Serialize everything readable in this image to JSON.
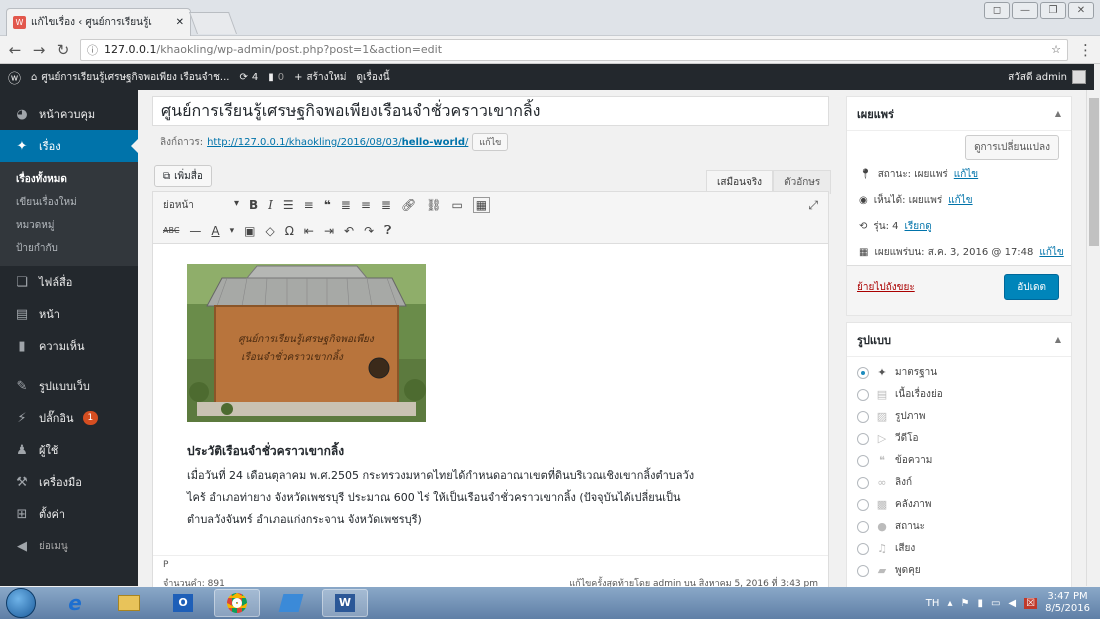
{
  "browser": {
    "tab_title": "แก้ไขเรื่อง ‹ ศูนย์การเรียนรู้เ",
    "url_host": "127.0.0.1",
    "url_path": "/khaokling/wp-admin/post.php?post=1&action=edit"
  },
  "adminbar": {
    "site": "ศูนย์การเรียนรู้เศรษฐกิจพอเพียง เรือนจำช...",
    "updates": "4",
    "comments": "0",
    "new_label": "สร้างใหม่",
    "view_label": "ดูเรื่องนี้",
    "greeting": "สวัสดี admin"
  },
  "sidebar": {
    "items": [
      {
        "label": "หน้าควบคุม",
        "icon": "dashboard-icon"
      },
      {
        "label": "เรื่อง",
        "icon": "pin-icon"
      },
      {
        "label": "ไฟล์สื่อ",
        "icon": "media-icon"
      },
      {
        "label": "หน้า",
        "icon": "page-icon"
      },
      {
        "label": "ความเห็น",
        "icon": "comment-icon"
      },
      {
        "label": "รูปแบบเว็บ",
        "icon": "appearance-icon"
      },
      {
        "label": "ปลั๊กอิน",
        "icon": "plugin-icon",
        "badge": "1"
      },
      {
        "label": "ผู้ใช้",
        "icon": "users-icon"
      },
      {
        "label": "เครื่องมือ",
        "icon": "tools-icon"
      },
      {
        "label": "ตั้งค่า",
        "icon": "settings-icon"
      },
      {
        "label": "ย่อเมนู",
        "icon": "collapse-icon"
      }
    ],
    "submenu": [
      "เรื่องทั้งหมด",
      "เขียนเรื่องใหม่",
      "หมวดหมู่",
      "ป้ายกำกับ"
    ]
  },
  "post": {
    "title": "ศูนย์การเรียนรู้เศรษฐกิจพอเพียงเรือนจำชั่วคราวเขากลิ้ง",
    "permalink_label": "ลิงก์ถาวร:",
    "permalink_base": "http://127.0.0.1/khaokling/2016/08/03/",
    "permalink_slug": "hello-world",
    "edit_btn": "แก้ไข",
    "add_media": "เพิ่มสื่อ",
    "tab_visual": "เสมือนจริง",
    "tab_text": "ตัวอักษร",
    "format_select": "ย่อหน้า",
    "photo_sign_line1": "ศูนย์การเรียนรู้เศรษฐกิจพอเพียง",
    "photo_sign_line2": "เรือนจำชั่วคราวเขากลิ้ง",
    "heading": "ประวัติเรือนจำชั่วคราวเขากลิ้ง",
    "paragraph": "เมื่อวันที่ 24 เดือนตุลาคม พ.ศ.2505 กระทรวงมหาดไทยได้กำหนดอาณาเขตที่ดินบริเวณเชิงเขากลิ้งตำบลวังไคร้ อำเภอท่ายาง จังหวัดเพชรบุรี ประมาณ 600 ไร่ ให้เป็นเรือนจำชั่วคราวเขากลิ้ง (ปัจจุบันได้เปลี่ยนเป็น ตำบลวังจันทร์ อำเภอแก่งกระจาน จังหวัดเพชรบุรี)",
    "path": "P",
    "word_count": "จำนวนคำ: 891",
    "last_edited": "แก้ไขครั้งสุดท้ายโดย admin บน สิงหาคม 5, 2016 ที่ 3:43 pm"
  },
  "publish": {
    "title": "เผยแพร่",
    "preview_btn": "ดูการเปลี่ยนแปลง",
    "status_label": "สถานะ: เผยแพร่",
    "visibility_label": "เห็นได้: เผยแพร่",
    "revisions_label": "รุ่น: 4",
    "revisions_link": "เรียกดู",
    "published_label": "เผยแพร่บน: ส.ค. 3, 2016 @ 17:48",
    "edit_link": "แก้ไข",
    "trash": "ย้ายไปถังขยะ",
    "update": "อัปเดต"
  },
  "format": {
    "title": "รูปแบบ",
    "options": [
      {
        "label": "มาตรฐาน",
        "icon": "pin-icon",
        "selected": true
      },
      {
        "label": "เนื้อเรื่องย่อ",
        "icon": "aside-icon"
      },
      {
        "label": "รูปภาพ",
        "icon": "image-icon"
      },
      {
        "label": "วีดีโอ",
        "icon": "video-icon"
      },
      {
        "label": "ข้อความ",
        "icon": "quote-icon"
      },
      {
        "label": "ลิงก์",
        "icon": "link-icon"
      },
      {
        "label": "คลังภาพ",
        "icon": "gallery-icon"
      },
      {
        "label": "สถานะ",
        "icon": "status-icon"
      },
      {
        "label": "เสียง",
        "icon": "audio-icon"
      },
      {
        "label": "พูดคุย",
        "icon": "chat-icon"
      }
    ]
  },
  "taskbar": {
    "lang": "TH",
    "time": "3:47 PM",
    "date": "8/5/2016"
  },
  "colors": {
    "wp_blue": "#0073aa",
    "update_btn": "#0085ba",
    "admin_dark": "#23282d"
  }
}
